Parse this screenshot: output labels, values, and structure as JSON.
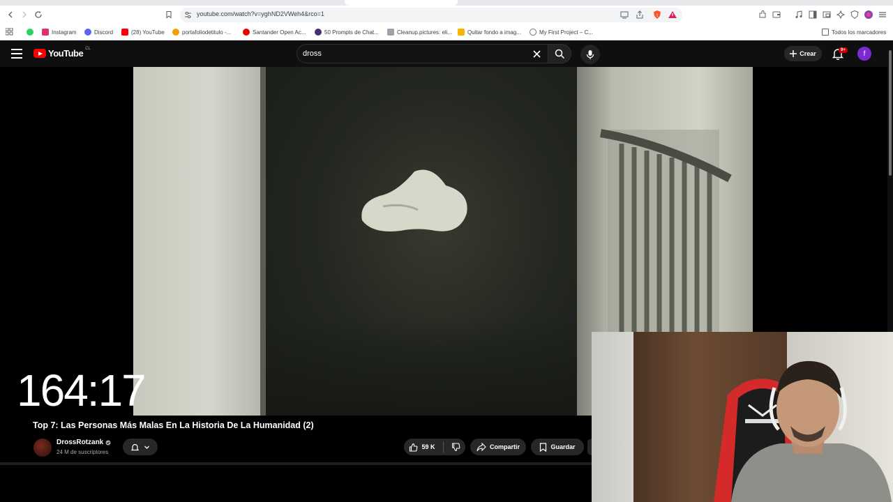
{
  "browser": {
    "url": "youtube.com/watch?v=yghND2VWeh4&rco=1",
    "bookmarks": [
      {
        "label": "",
        "color": "#25d366"
      },
      {
        "label": "Instagram",
        "color": "#e1306c"
      },
      {
        "label": "Discord",
        "color": "#5865f2"
      },
      {
        "label": "(28) YouTube",
        "color": "#ff0000"
      },
      {
        "label": "portafoliodetitulo -...",
        "color": "#f59e0b"
      },
      {
        "label": "Santander Open Ac...",
        "color": "#ec0000"
      },
      {
        "label": "50 Prompts de Chat...",
        "color": "#4b2f73"
      },
      {
        "label": "Cleanup.pictures: eli...",
        "color": "#9ca3af"
      },
      {
        "label": "Quitar fondo a imag...",
        "color": "#f5b400"
      },
      {
        "label": "My First Project – C...",
        "color": "#6b7280"
      }
    ],
    "bookmarks_folder": "Todos los marcadores"
  },
  "youtube": {
    "logo_text": "YouTube",
    "country_code": "CL",
    "search_query": "dross",
    "create_label": "Crear",
    "notification_badge": "9+",
    "avatar_letter": "f"
  },
  "video": {
    "overlay_time": "164:17",
    "title": "Top 7: Las Personas Más Malas En La Historia De La Humanidad (2)",
    "channel_name": "DrossRotzank",
    "subscribers": "24 M de suscriptores",
    "likes": "59 K",
    "share_label": "Compartir",
    "save_label": "Guardar"
  },
  "colors": {
    "yt_red": "#ff0000",
    "yt_dark": "#0f0f0f",
    "pill_bg": "#272727",
    "avatar_purple": "#7b2ad2"
  },
  "icons": [
    "back-icon",
    "forward-icon",
    "reload-icon",
    "bookmark-star-icon",
    "site-settings-icon",
    "cast-icon",
    "share-page-icon",
    "brave-shield-icon",
    "brave-rewards-icon",
    "extensions-icon",
    "menu-icon",
    "search-icon",
    "mic-icon",
    "bell-icon",
    "like-icon",
    "dislike-icon",
    "share-icon",
    "save-icon",
    "verified-icon"
  ]
}
